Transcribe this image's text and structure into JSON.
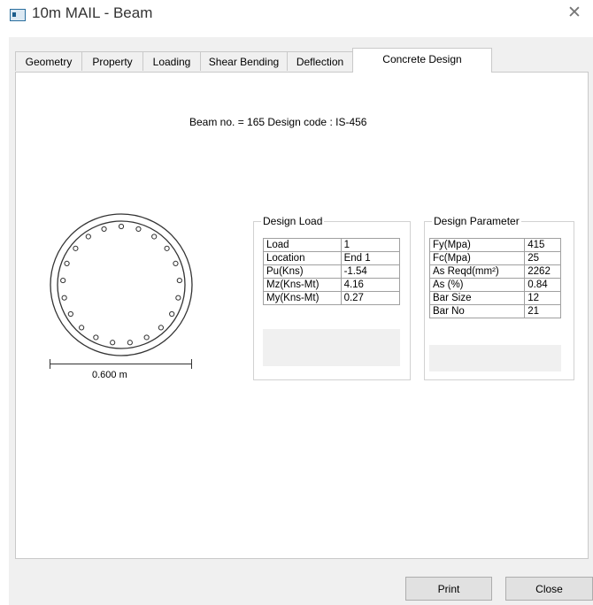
{
  "window": {
    "title": "10m MAIL - Beam",
    "close_glyph": "✕"
  },
  "tabs": [
    {
      "label": "Geometry"
    },
    {
      "label": "Property"
    },
    {
      "label": "Loading"
    },
    {
      "label": "Shear Bending"
    },
    {
      "label": "Deflection"
    },
    {
      "label": "Concrete Design"
    }
  ],
  "header": {
    "text": "Beam no. = 165  Design code :  IS-456"
  },
  "section": {
    "dimension_label": "0.600 m",
    "bar_count": 21
  },
  "design_load": {
    "legend": "Design Load",
    "rows": [
      {
        "key": "Load",
        "value": "1"
      },
      {
        "key": "Location",
        "value": "End 1"
      },
      {
        "key": "Pu(Kns)",
        "value": "-1.54"
      },
      {
        "key": "Mz(Kns-Mt)",
        "value": "4.16"
      },
      {
        "key": "My(Kns-Mt)",
        "value": "0.27"
      }
    ]
  },
  "design_parameter": {
    "legend": "Design Parameter",
    "rows": [
      {
        "key": "Fy(Mpa)",
        "value": "415"
      },
      {
        "key": "Fc(Mpa)",
        "value": "25"
      },
      {
        "key": "As Reqd(mm²)",
        "value": "2262"
      },
      {
        "key": "As (%)",
        "value": "0.84"
      },
      {
        "key": "Bar Size",
        "value": "12"
      },
      {
        "key": "Bar No",
        "value": "21"
      }
    ]
  },
  "buttons": {
    "print": "Print",
    "close": "Close"
  }
}
